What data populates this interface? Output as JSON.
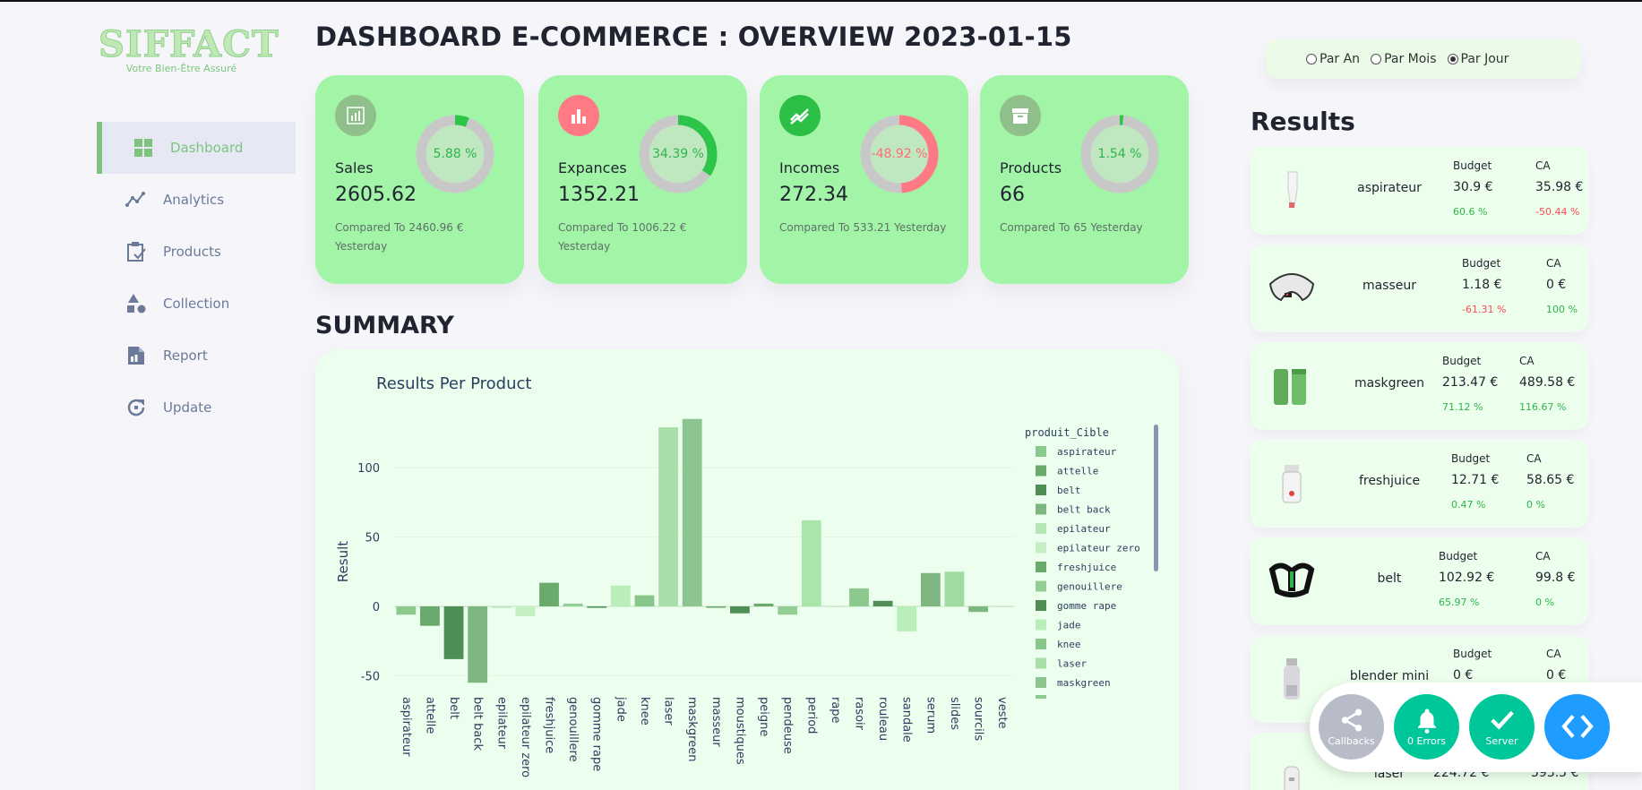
{
  "app": {
    "logo_text": "SIFFACT",
    "logo_tagline": "Votre Bien-Être Assuré"
  },
  "sidebar": {
    "items": [
      {
        "label": "Dashboard",
        "icon": "grid-icon",
        "active": true
      },
      {
        "label": "Analytics",
        "icon": "trend-line-icon",
        "active": false
      },
      {
        "label": "Products",
        "icon": "clipboard-check-icon",
        "active": false
      },
      {
        "label": "Collection",
        "icon": "shapes-icon",
        "active": false
      },
      {
        "label": "Report",
        "icon": "document-icon",
        "active": false
      },
      {
        "label": "Update",
        "icon": "refresh-icon",
        "active": false
      }
    ]
  },
  "header": {
    "title": "DASHBOARD E-COMMERCE : OVERVIEW 2023-01-15"
  },
  "cards": [
    {
      "label": "Sales",
      "value": "2605.62",
      "percent_text": "5.88 %",
      "percent": 5.88,
      "compare_text": "Compared To 2460.96 € Yesterday",
      "icon": "bar-chart-icon",
      "icon_bg": "#8fbf8b",
      "ring_color": "#2cc54a",
      "text_color": "#2db54a"
    },
    {
      "label": "Expances",
      "value": "1352.21",
      "percent_text": "34.39 %",
      "percent": 34.39,
      "compare_text": "Compared To 1006.22 € Yesterday",
      "icon": "bar-chart-icon",
      "icon_bg": "#ff7a85",
      "ring_color": "#2cc54a",
      "text_color": "#2db54a"
    },
    {
      "label": "Incomes",
      "value": "272.34",
      "percent_text": "-48.92 %",
      "percent": 48.92,
      "compare_text": "Compared To 533.21 Yesterday",
      "icon": "trending-up-icon",
      "icon_bg": "#2cbf45",
      "ring_color": "#ff7a85",
      "text_color": "#ff6b78"
    },
    {
      "label": "Products",
      "value": "66",
      "percent_text": "1.54 %",
      "percent": 1.54,
      "compare_text": "Compared To 65 Yesterday",
      "icon": "archive-icon",
      "icon_bg": "#8fbf8b",
      "ring_color": "#2cc54a",
      "text_color": "#2db54a"
    }
  ],
  "summary": {
    "title": "SUMMARY"
  },
  "chart_data": {
    "type": "bar",
    "title": "Results Per Product",
    "ylabel": "Result",
    "xlabel": "",
    "yticks": [
      -50,
      0,
      50,
      100
    ],
    "ylim": [
      -60,
      140
    ],
    "legend_title": "produit_Cible",
    "legend_entries": [
      "aspirateur",
      "attelle",
      "belt",
      "belt back",
      "epilateur",
      "epilateur zero",
      "freshjuice",
      "genouillere",
      "gomme rape",
      "jade",
      "knee",
      "laser",
      "maskgreen"
    ],
    "categories": [
      "aspirateur",
      "attelle",
      "belt",
      "belt back",
      "epilateur",
      "epilateur zero",
      "freshjuice",
      "genouillere",
      "gomme rape",
      "jade",
      "knee",
      "laser",
      "maskgreen",
      "masseur",
      "moustiques",
      "peigne",
      "pendeuse",
      "period",
      "rape",
      "rasoir",
      "rouleau",
      "sandale",
      "serum",
      "slides",
      "sourcils",
      "veste"
    ],
    "values": [
      -6,
      -14,
      -38,
      -55,
      -1,
      -7,
      17,
      2,
      -1,
      15,
      8,
      129,
      135,
      -1,
      -5,
      2,
      -6,
      62,
      0,
      13,
      4,
      -18,
      24,
      25,
      -4,
      0
    ],
    "colors": [
      "#8cc98e",
      "#6aaa6d",
      "#4f8f55",
      "#7db680",
      "#b6e6b6",
      "#c3efc3",
      "#6aaa6d",
      "#93cf95",
      "#4f8f55",
      "#b9edb9",
      "#89c68c",
      "#a8dfa9",
      "#8dc591",
      "#6aaa6d",
      "#4f8f55",
      "#6aaa6d",
      "#93cf95",
      "#a8e6a9",
      "#c3efc3",
      "#8cc98e",
      "#4f8f55",
      "#b9edb9",
      "#7db680",
      "#a0dca1",
      "#7db680",
      "#c3efc3"
    ]
  },
  "filter": {
    "options": [
      {
        "label": "Par An",
        "checked": false
      },
      {
        "label": "Par Mois",
        "checked": false
      },
      {
        "label": "Par Jour",
        "checked": true
      }
    ]
  },
  "results": {
    "title": "Results",
    "budget_header": "Budget",
    "ca_header": "CA",
    "items": [
      {
        "name": "aspirateur",
        "budget": "30.9 €",
        "ca": "35.98 €",
        "budget_pct": "60.6 %",
        "ca_pct": "-50.44 %",
        "budget_pct_color": "#2db54a",
        "ca_pct_color": "#ff4b55",
        "image": "aspirateur-product-image"
      },
      {
        "name": "masseur",
        "budget": "1.18 €",
        "ca": "0 €",
        "budget_pct": "-61.31 %",
        "ca_pct": "100 %",
        "budget_pct_color": "#ff4b55",
        "ca_pct_color": "#2db54a",
        "image": "masseur-product-image"
      },
      {
        "name": "maskgreen",
        "budget": "213.47 €",
        "ca": "489.58 €",
        "budget_pct": "71.12 %",
        "ca_pct": "116.67 %",
        "budget_pct_color": "#2db54a",
        "ca_pct_color": "#2db54a",
        "image": "maskgreen-product-image"
      },
      {
        "name": "freshjuice",
        "budget": "12.71 €",
        "ca": "58.65 €",
        "budget_pct": "0.47 %",
        "ca_pct": "0 %",
        "budget_pct_color": "#2db54a",
        "ca_pct_color": "#2db54a",
        "image": "freshjuice-product-image"
      },
      {
        "name": "belt",
        "budget": "102.92 €",
        "ca": "99.8 €",
        "budget_pct": "65.97 %",
        "ca_pct": "0 %",
        "budget_pct_color": "#2db54a",
        "ca_pct_color": "#2db54a",
        "image": "belt-product-image"
      },
      {
        "name": "blender mini",
        "budget": "0 €",
        "ca": "0 €",
        "budget_pct": "",
        "ca_pct": "",
        "budget_pct_color": "#2db54a",
        "ca_pct_color": "#2db54a",
        "image": "blender-product-image"
      },
      {
        "name": "laser",
        "budget": "224.72 €",
        "ca": "593.5 €",
        "budget_pct": "",
        "ca_pct": "",
        "budget_pct_color": "#2db54a",
        "ca_pct_color": "#2db54a",
        "image": "laser-product-image"
      }
    ]
  },
  "devtools": {
    "callbacks_label": "Callbacks",
    "errors_label": "0 Errors",
    "server_label": "Server",
    "callbacks_color": "#b7bcc8",
    "errors_color": "#00c79a",
    "server_color": "#00c79a",
    "toggle_color": "#1f9cff"
  }
}
